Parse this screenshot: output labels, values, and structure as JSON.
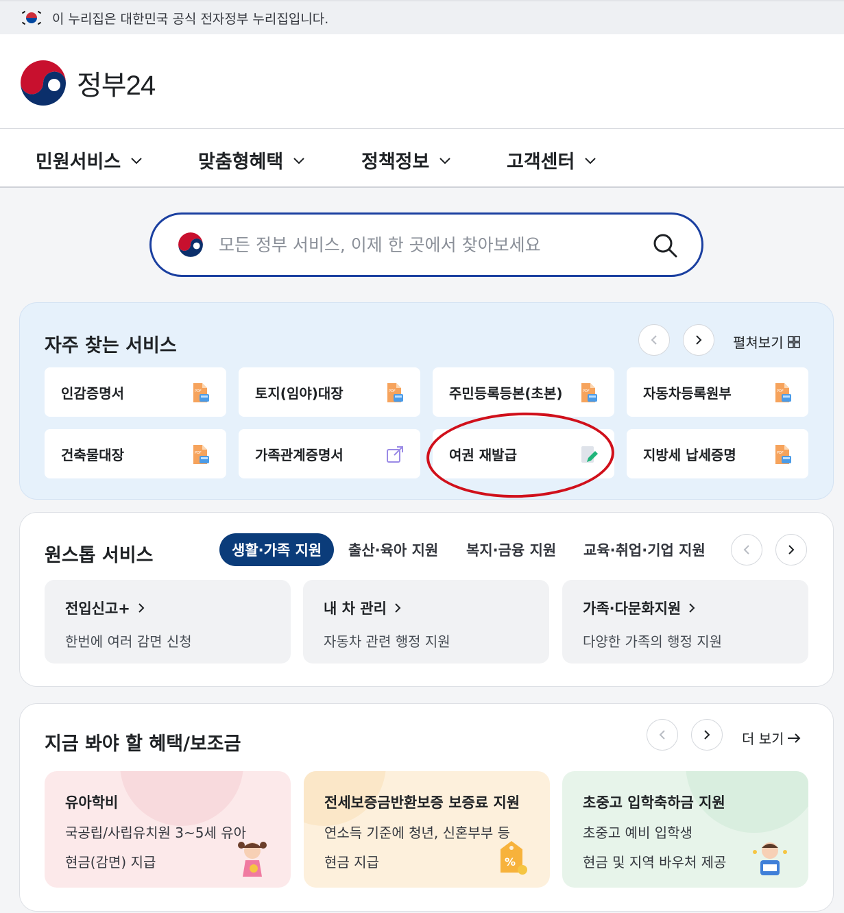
{
  "gov_banner": {
    "text": "이 누리집은 대한민국 공식 전자정부 누리집입니다."
  },
  "header": {
    "logo_text": "정부24"
  },
  "nav": {
    "items": [
      {
        "label": "민원서비스"
      },
      {
        "label": "맞춤형혜택"
      },
      {
        "label": "정책정보"
      },
      {
        "label": "고객센터"
      }
    ]
  },
  "search": {
    "placeholder": "모든 정부 서비스, 이제 한 곳에서 찾아보세요"
  },
  "frequent": {
    "title": "자주 찾는 서비스",
    "expand_label": "펼쳐보기",
    "items": [
      {
        "label": "인감증명서",
        "icon": "pdf-document-icon"
      },
      {
        "label": "토지(임야)대장",
        "icon": "pdf-document-icon"
      },
      {
        "label": "주민등록등본(초본)",
        "icon": "pdf-document-icon"
      },
      {
        "label": "자동차등록원부",
        "icon": "pdf-document-icon"
      },
      {
        "label": "건축물대장",
        "icon": "pdf-document-icon"
      },
      {
        "label": "가족관계증명서",
        "icon": "external-link-icon"
      },
      {
        "label": "여권 재발급",
        "icon": "edit-document-icon"
      },
      {
        "label": "지방세 납세증명",
        "icon": "pdf-document-icon"
      }
    ]
  },
  "onestop": {
    "title": "원스톱 서비스",
    "tabs": [
      {
        "label": "생활·가족 지원",
        "active": true
      },
      {
        "label": "출산·육아 지원"
      },
      {
        "label": "복지·금융 지원"
      },
      {
        "label": "교육·취업·기업 지원"
      }
    ],
    "cards": [
      {
        "title": "전입신고+",
        "desc": "한번에 여러 감면 신청"
      },
      {
        "title": "내 차 관리",
        "desc": "자동차 관련 행정 지원"
      },
      {
        "title": "가족·다문화지원",
        "desc": "다양한 가족의 행정 지원"
      }
    ]
  },
  "benefits": {
    "title": "지금 봐야 할 혜택/보조금",
    "more_label": "더 보기",
    "cards": [
      {
        "title": "유아학비",
        "line1": "국공립/사립유치원 3~5세 유아",
        "line2": "현금(감면) 지급",
        "bg": "#fce9ea"
      },
      {
        "title": "전세보증금반환보증 보증료 지원",
        "line1": "연소득 기준에 청년, 신혼부부 등",
        "line2": "현금 지급",
        "bg": "#fdf0dc"
      },
      {
        "title": "초중고 입학축하금 지원",
        "line1": "초중고 예비 입학생",
        "line2": "현금 및 지역 바우처 제공",
        "bg": "#e7f4ea"
      }
    ]
  },
  "colors": {
    "brand_blue": "#1a3fa0",
    "active_tab": "#0b3c7a",
    "annotation": "#d0101b"
  }
}
